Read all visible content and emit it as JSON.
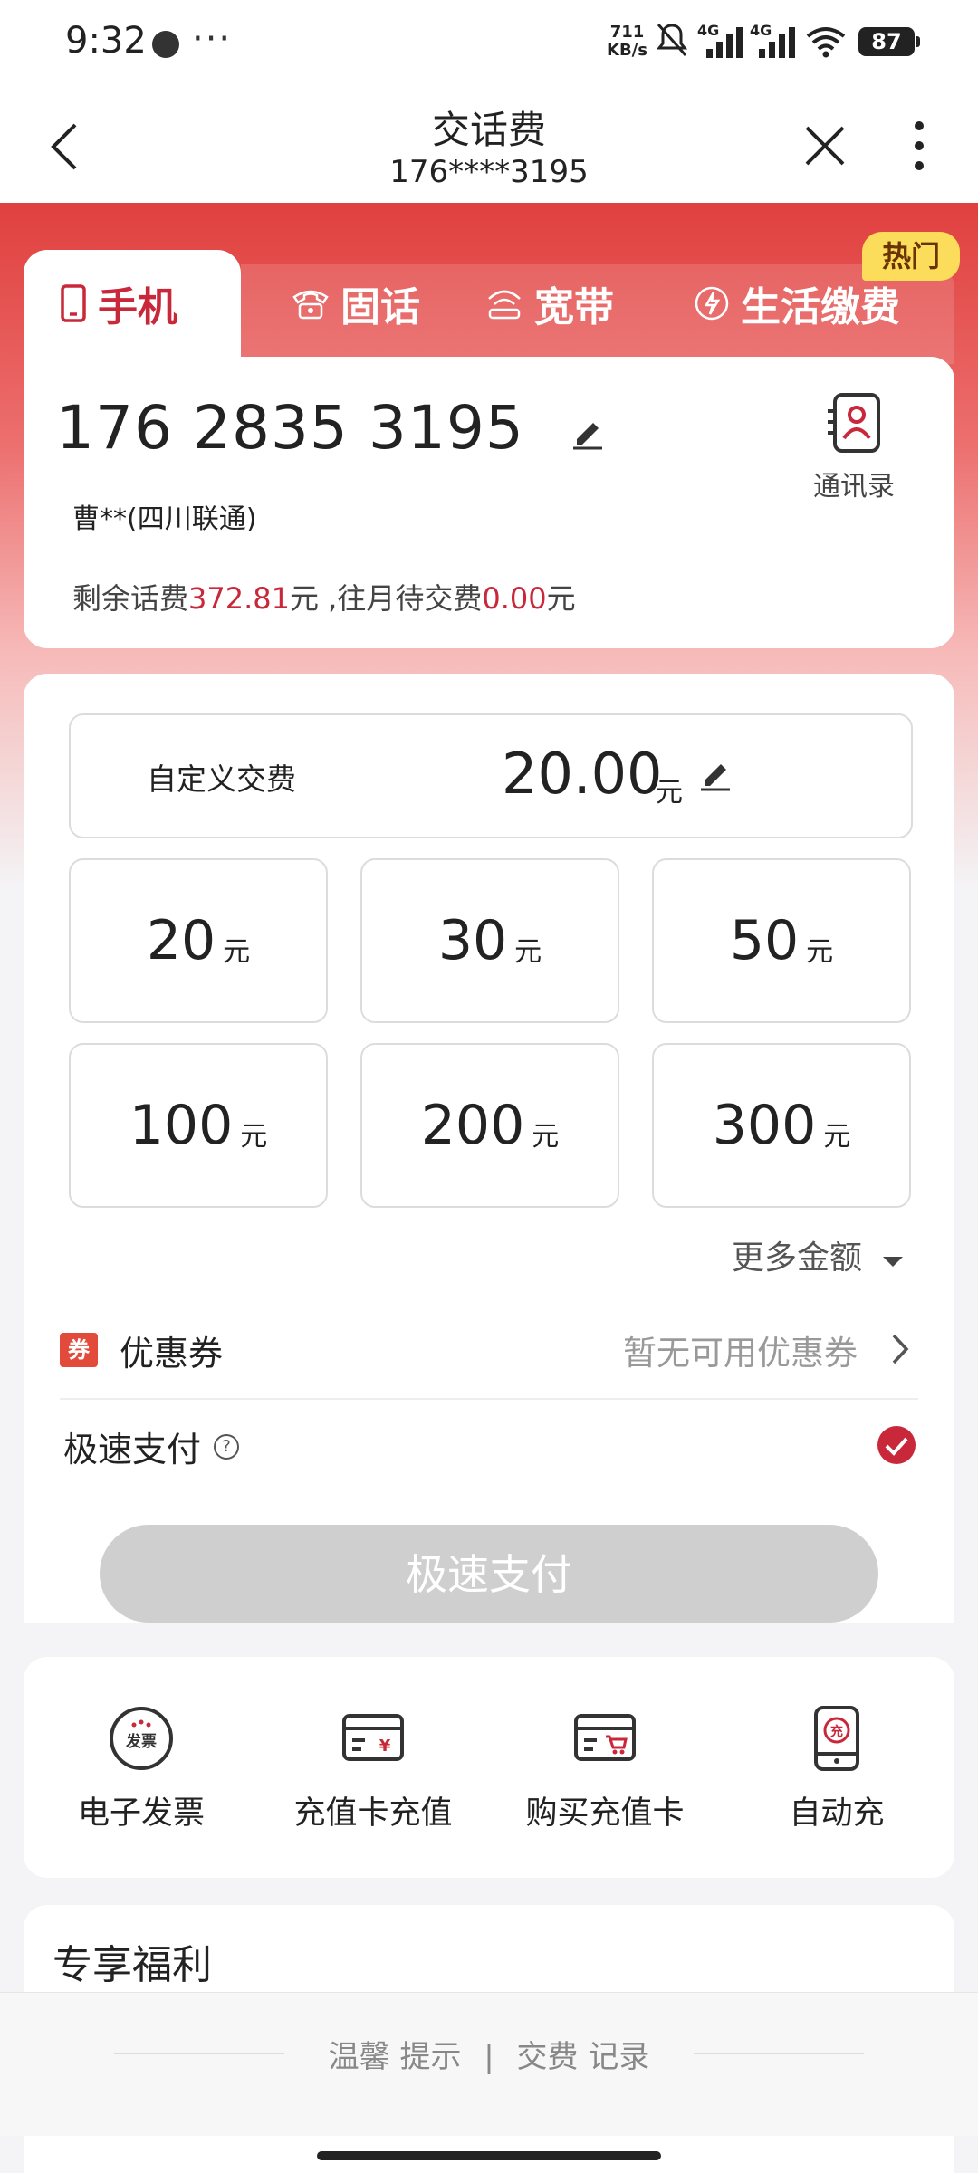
{
  "status_bar": {
    "time": "9:32",
    "dots": "···",
    "speed_value": "711",
    "speed_unit": "KB/s",
    "net_1": "4G",
    "net_2": "4G",
    "battery": "87"
  },
  "header": {
    "title": "交话费",
    "subtitle": "176****3195"
  },
  "tabs": [
    {
      "label": "手机",
      "active": true
    },
    {
      "label": "固话",
      "active": false
    },
    {
      "label": "宽带",
      "active": false
    },
    {
      "label": "生活缴费",
      "active": false
    }
  ],
  "hot_badge": "热门",
  "phone_card": {
    "number": "176 2835 3195",
    "owner": "曹**(四川联通)",
    "contacts_label": "通讯录",
    "balance_prefix": "剩余话费",
    "balance_value": "372.81",
    "balance_unit": "元 ,往月待交费",
    "pending_value": "0.00",
    "pending_unit": "元"
  },
  "custom_pay": {
    "label": "自定义交费",
    "amount": "20.00",
    "unit": "元"
  },
  "amount_options": [
    {
      "value": "20",
      "unit": "元"
    },
    {
      "value": "30",
      "unit": "元"
    },
    {
      "value": "50",
      "unit": "元"
    },
    {
      "value": "100",
      "unit": "元"
    },
    {
      "value": "200",
      "unit": "元"
    },
    {
      "value": "300",
      "unit": "元"
    }
  ],
  "more_amounts": "更多金额",
  "coupon": {
    "badge": "券",
    "label": "优惠券",
    "status": "暂无可用优惠券"
  },
  "express_pay": {
    "label": "极速支付",
    "help": "?",
    "checked": true
  },
  "pay_button": "极速支付",
  "services": [
    {
      "label": "电子发票",
      "icon": "invoice-icon",
      "icon_text": "发票"
    },
    {
      "label": "充值卡充值",
      "icon": "card-recharge-icon",
      "icon_text": "¥"
    },
    {
      "label": "购买充值卡",
      "icon": "buy-card-icon",
      "icon_text": ""
    },
    {
      "label": "自动充",
      "icon": "auto-recharge-icon",
      "icon_text": "充"
    }
  ],
  "benefits_title": "专享福利",
  "footer": {
    "tips": "温馨 提示",
    "separator": "|",
    "records": "交费 记录"
  },
  "colors": {
    "brand_red": "#e0403e",
    "accent_red": "#c8283a",
    "hot_yellow": "#fbdc5b",
    "disabled_gray": "#cfcfcf"
  }
}
